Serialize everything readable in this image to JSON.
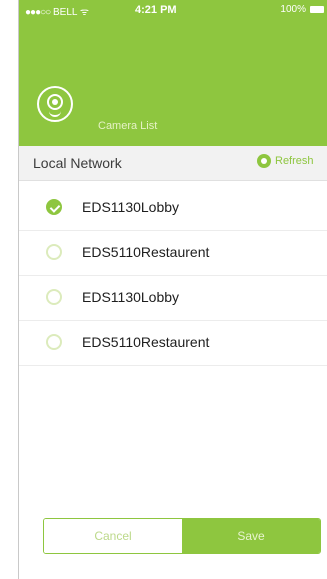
{
  "colors": {
    "accent": "#8ec63f"
  },
  "status_bar": {
    "carrier": "BELL",
    "time": "4:21 PM",
    "battery": "100%"
  },
  "header": {
    "title": "Camera List",
    "icon": "camera-icon"
  },
  "section": {
    "title": "Local Network",
    "refresh_label": "Refresh"
  },
  "cameras": [
    {
      "name": "EDS1130Lobby",
      "selected": true
    },
    {
      "name": "EDS5110Restaurent",
      "selected": false
    },
    {
      "name": "EDS1130Lobby",
      "selected": false
    },
    {
      "name": "EDS5110Restaurent",
      "selected": false
    }
  ],
  "buttons": {
    "cancel": "Cancel",
    "save": "Save"
  }
}
